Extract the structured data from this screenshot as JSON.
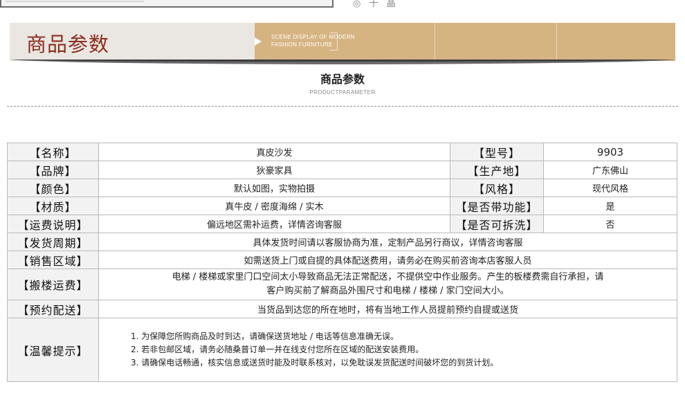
{
  "header": {
    "title": "商品参数",
    "banner_sub_line1": "SCENE DISPLAY OF MODERN",
    "banner_sub_line2": "FASHION FURNITURE",
    "accent_color": "#d6b482",
    "title_color": "#8c2d1f"
  },
  "section": {
    "title": "商品参数",
    "subtitle": "PRODUCTPARAMETER"
  },
  "params": {
    "name_label": "【名称】",
    "name_value": "真皮沙发",
    "model_label": "【型号】",
    "model_value": "9903",
    "brand_label": "【品牌】",
    "brand_value": "狄豪家具",
    "origin_label": "【生产地】",
    "origin_value": "广东佛山",
    "color_label": "【颜色】",
    "color_value": "默认如图，实物拍摄",
    "style_label": "【风格】",
    "style_value": "现代风格",
    "material_label": "【材质】",
    "material_value": "真牛皮 / 密度海绵 / 实木",
    "function_label": "【是否带功能】",
    "function_value": "是",
    "shipping_label": "【运费说明】",
    "shipping_value": "偏远地区需补运费，详情咨询客服",
    "washable_label": "【是否可拆洗】",
    "washable_value": "否",
    "delivery_cycle_label": "【发货周期】",
    "delivery_cycle_value": "具体发货时间请以客服协商为准，定制产品另行商议，详情咨询客服",
    "sales_area_label": "【销售区域】",
    "sales_area_value": "如需送货上门或自提的具体配送费用，请务必在购买前咨询本店客服人员",
    "stairs_label": "【搬楼运费】",
    "stairs_line1": "电梯 / 楼梯或家里门口空间太小导致商品无法正常配送，不提供空中作业服务。产生的板楼费需自行承担，请",
    "stairs_line2": "客户购买前了解商品外围尺寸和电梯 / 楼梯 / 家门空间大小。",
    "appointment_label": "【预约配送】",
    "appointment_value": "当货品到达您的所在地时，将有当地工作人员提前预约自提或送货",
    "tips_label": "【温馨提示】",
    "tips": [
      "1. 为保障您所购商品及时到达，请确保送货地址 / 电话等信息准确无误。",
      "2. 若非包邮区域，请务必随桑普订单一并在线支付您所在区域的配送安装费用。",
      "3. 请确保电话畅通，核实信息或送货时能及时联系核对，以免耽误发货配送时间破坏您的到货计划。"
    ]
  }
}
